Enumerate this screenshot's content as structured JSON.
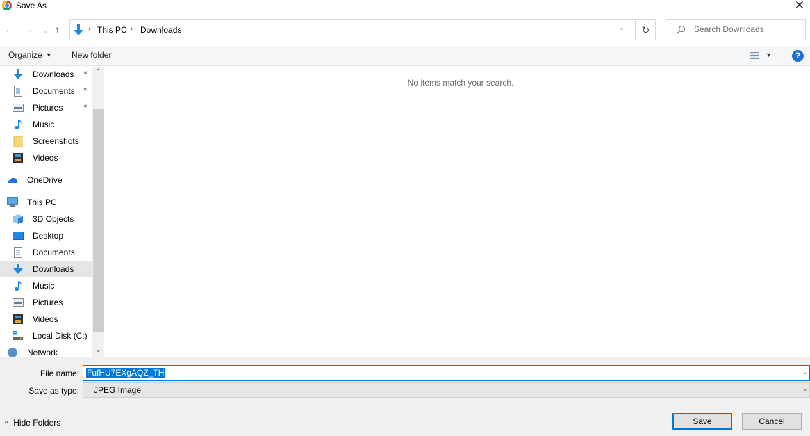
{
  "window": {
    "title": "Save As",
    "app_icon": "chrome-icon",
    "close_glyph": "✕"
  },
  "nav": {
    "back_glyph": "←",
    "forward_glyph": "→",
    "recent_glyph": "⌄",
    "up_glyph": "↑",
    "breadcrumb": [
      {
        "label": "This PC"
      },
      {
        "label": "Downloads"
      }
    ],
    "crumb_sep": "›",
    "dropdown_glyph": "⌄",
    "refresh_glyph": "↻",
    "search_placeholder": "Search Downloads",
    "search_value": ""
  },
  "toolbar": {
    "organize_label": "Organize",
    "caret_glyph": "▼",
    "new_folder_label": "New folder",
    "help_glyph": "?"
  },
  "navpane": {
    "items": [
      {
        "label": "Downloads",
        "icon": "downloads-icon",
        "pinned": true
      },
      {
        "label": "Documents",
        "icon": "documents-icon",
        "pinned": true
      },
      {
        "label": "Pictures",
        "icon": "pictures-icon",
        "pinned": true
      },
      {
        "label": "Music",
        "icon": "music-icon",
        "pinned": false
      },
      {
        "label": "Screenshots",
        "icon": "folder-icon",
        "pinned": false
      },
      {
        "label": "Videos",
        "icon": "videos-icon",
        "pinned": false
      },
      {
        "label": "OneDrive",
        "icon": "onedrive-icon",
        "pinned": false
      },
      {
        "label": "This PC",
        "icon": "this-pc-icon",
        "pinned": false
      },
      {
        "label": "3D Objects",
        "icon": "3d-objects-icon",
        "pinned": false
      },
      {
        "label": "Desktop",
        "icon": "desktop-icon",
        "pinned": false
      },
      {
        "label": "Documents",
        "icon": "documents-icon",
        "pinned": false
      },
      {
        "label": "Downloads",
        "icon": "downloads-icon",
        "pinned": false,
        "selected": true
      },
      {
        "label": "Music",
        "icon": "music-icon",
        "pinned": false
      },
      {
        "label": "Pictures",
        "icon": "pictures-icon",
        "pinned": false
      },
      {
        "label": "Videos",
        "icon": "videos-icon",
        "pinned": false
      },
      {
        "label": "Local Disk (C:)",
        "icon": "local-disk-icon",
        "pinned": false
      },
      {
        "label": "Network",
        "icon": "network-icon",
        "pinned": false
      }
    ],
    "pin_glyph": "📌",
    "scroll_up_glyph": "⌃",
    "scroll_down_glyph": "⌄"
  },
  "content": {
    "empty_message": "No items match your search."
  },
  "bottom": {
    "file_name_label": "File name:",
    "file_name_value": "FufHU7EXgAQZ_TH",
    "save_as_type_label": "Save as type:",
    "save_as_type_value": "JPEG Image",
    "dropdown_glyph": "⌄",
    "hide_folders_label": "Hide Folders",
    "hide_folders_glyph": "^",
    "save_label": "Save",
    "cancel_label": "Cancel"
  },
  "colors": {
    "accent": "#0078d7",
    "selected_bg": "#e5e5e5",
    "toolbar_bg": "#f5f6f7",
    "bottom_bg": "#f0f0f0"
  }
}
